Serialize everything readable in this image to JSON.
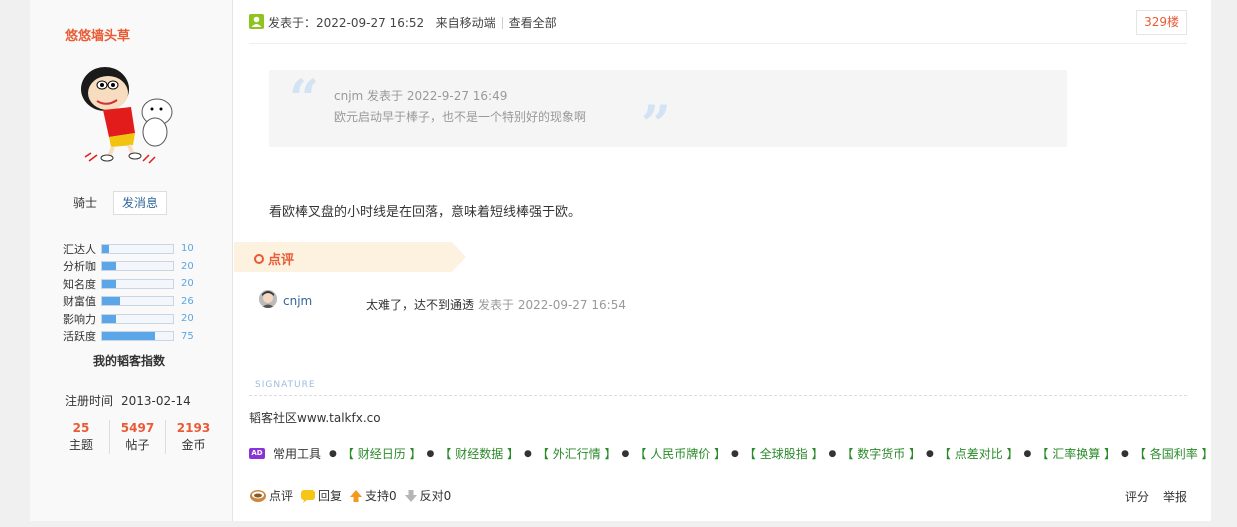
{
  "author": {
    "username": "悠悠墙头草",
    "rank": "骑士",
    "message_button": "发消息",
    "stats": [
      {
        "label": "汇达人",
        "value": 10
      },
      {
        "label": "分析咖",
        "value": 20
      },
      {
        "label": "知名度",
        "value": 20
      },
      {
        "label": "财富值",
        "value": 26
      },
      {
        "label": "影响力",
        "value": 20
      },
      {
        "label": "活跃度",
        "value": 75
      }
    ],
    "stats_title": "我的韬客指数",
    "reg_label": "注册时间",
    "reg_date": "2013-02-14",
    "counts": [
      {
        "num": "25",
        "label": "主题"
      },
      {
        "num": "5497",
        "label": "帖子"
      },
      {
        "num": "2193",
        "label": "金币"
      }
    ]
  },
  "post": {
    "posted_at": "发表于：2022-09-27 16:52",
    "source": "来自移动端",
    "view_all": "查看全部",
    "floor": "329楼",
    "quote": {
      "header": "cnjm 发表于 2022-9-27 16:49",
      "text": "欧元启动早于棒子，也不是一个特别好的现象啊"
    },
    "message": "看欧棒叉盘的小时线是在回落，意味着短线棒强于欧。"
  },
  "comments": {
    "title": "点评",
    "items": [
      {
        "user": "cnjm",
        "text": "太难了，达不到通透",
        "time": "发表于 2022-09-27 16:54"
      }
    ]
  },
  "signature": {
    "label": "SIGNATURE",
    "text": "韬客社区www.talkfx.co"
  },
  "tools": {
    "ad": "AD",
    "label": "常用工具",
    "links": [
      "【 财经日历 】",
      "【 财经数据 】",
      "【 外汇行情 】",
      "【 人民币牌价 】",
      "【 全球股指 】",
      "【 数字货币 】",
      "【 点差对比 】",
      "【 汇率换算 】",
      "【 各国利率 】"
    ]
  },
  "actions": {
    "comment": "点评",
    "reply": "回复",
    "support": "支持0",
    "oppose": "反对0",
    "rate": "评分",
    "report": "举报"
  },
  "colors": {
    "accent": "#e95b35",
    "link": "#336699",
    "stat_bar": "#5aa6e8",
    "tool_link": "#2a8a2a"
  }
}
